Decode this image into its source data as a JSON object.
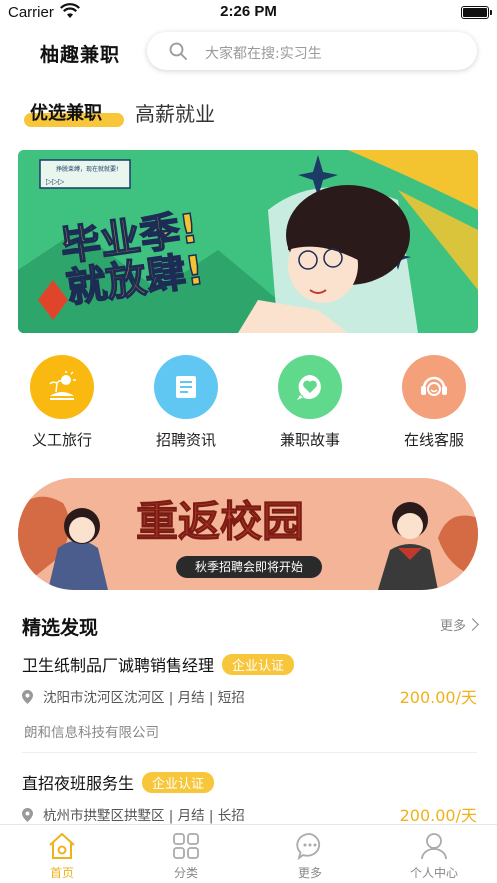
{
  "status_bar": {
    "carrier": "Carrier",
    "time": "2:26 PM"
  },
  "header": {
    "logo": "柚趣兼职",
    "search_placeholder": "大家都在搜:实习生"
  },
  "tabs": {
    "active": "优选兼职",
    "inactive": "高薪就业"
  },
  "banner1": {
    "headline_line1": "毕业季!",
    "headline_line2": "就放肆!",
    "screen_text": "挣脱束缚，现在就就要!"
  },
  "categories": [
    {
      "label": "义工旅行",
      "icon": "island-sun-icon",
      "color": "#f9b911"
    },
    {
      "label": "招聘资讯",
      "icon": "document-icon",
      "color": "#5fc7f2"
    },
    {
      "label": "兼职故事",
      "icon": "heart-chat-icon",
      "color": "#61d98d"
    },
    {
      "label": "在线客服",
      "icon": "headset-icon",
      "color": "#f4a07a"
    }
  ],
  "banner2": {
    "headline": "重返校园",
    "subtitle": "秋季招聘会即将开始"
  },
  "section": {
    "title": "精选发现",
    "more": "更多"
  },
  "jobs": [
    {
      "title": "卫生纸制品厂诚聘销售经理",
      "badge": "企业认证",
      "meta": "沈阳市沈河区沈河区 | 月结 | 短招",
      "salary": "200.00/天",
      "company": "朗和信息科技有限公司"
    },
    {
      "title": "直招夜班服务生",
      "badge": "企业认证",
      "meta": "杭州市拱墅区拱墅区 | 月结 | 长招",
      "salary": "200.00/天"
    }
  ],
  "tabbar": {
    "items": [
      {
        "label": "首页",
        "icon": "home-icon",
        "active": true
      },
      {
        "label": "分类",
        "icon": "grid-icon",
        "active": false
      },
      {
        "label": "更多",
        "icon": "chat-bubble-icon",
        "active": false
      },
      {
        "label": "个人中心",
        "icon": "person-icon",
        "active": false
      }
    ],
    "accent": "#f0b21c"
  }
}
